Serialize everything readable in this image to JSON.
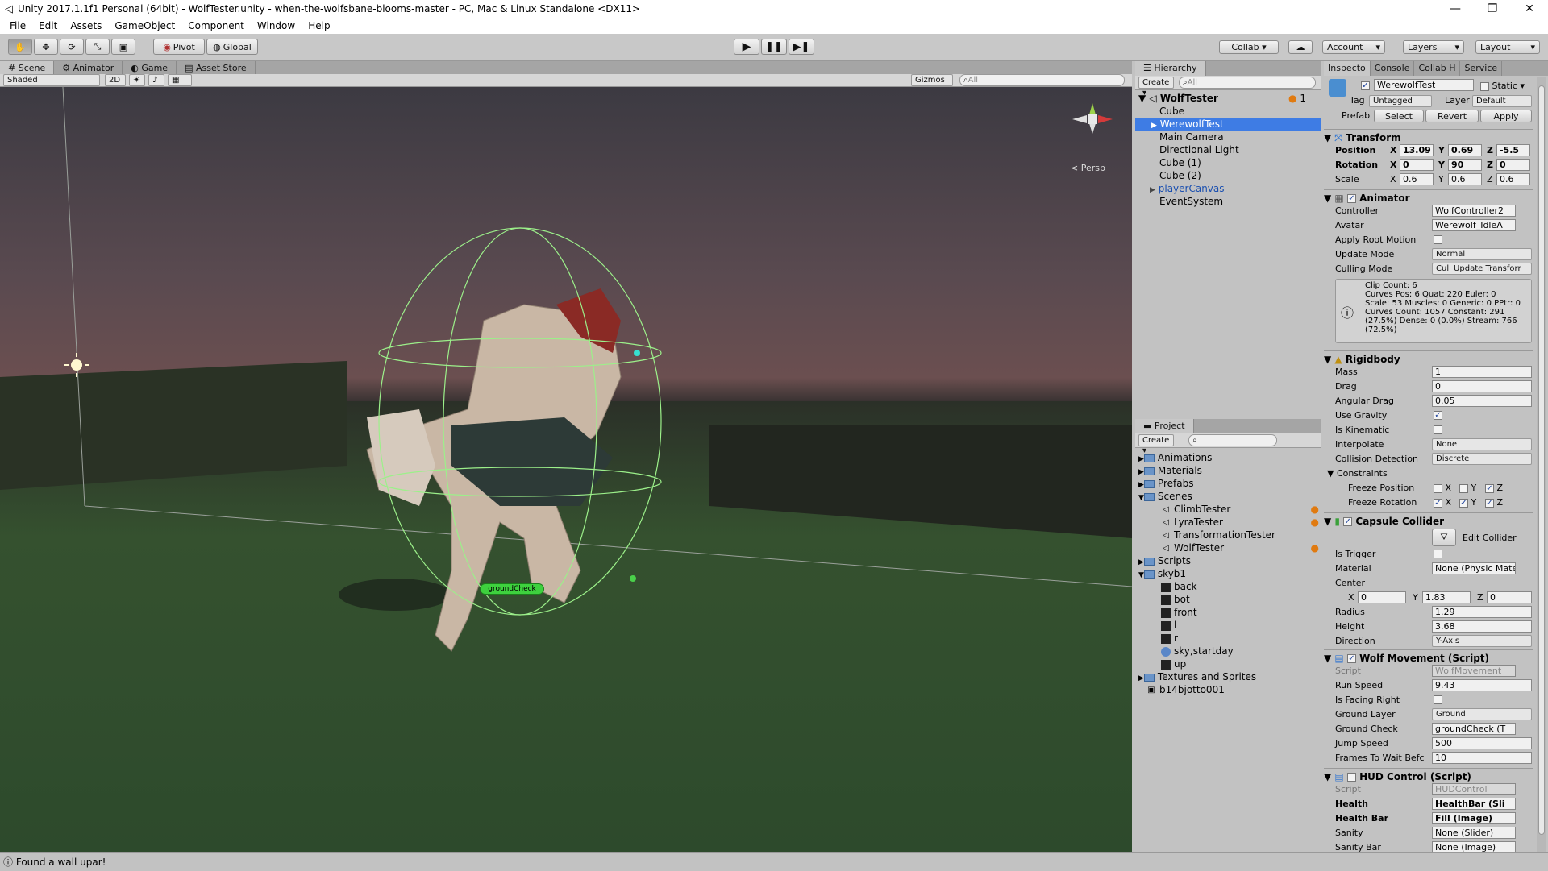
{
  "window": {
    "title": "Unity 2017.1.1f1 Personal (64bit) - WolfTester.unity - when-the-wolfsbane-blooms-master - PC, Mac & Linux Standalone <DX11>",
    "minimize": "—",
    "maximize": "❐",
    "close": "✕"
  },
  "menu": [
    "File",
    "Edit",
    "Assets",
    "GameObject",
    "Component",
    "Window",
    "Help"
  ],
  "toolbar": {
    "pivot": "Pivot",
    "global": "Global",
    "collab": "Collab ▾",
    "account": "Account",
    "layers": "Layers",
    "layout": "Layout"
  },
  "scene_tabs": {
    "scene": "Scene",
    "animator": "Animator",
    "game": "Game",
    "asset_store": "Asset Store"
  },
  "scene_bar": {
    "shaded": "Shaded",
    "twod": "2D",
    "gizmos": "Gizmos",
    "search_placeholder": "All"
  },
  "scene_view": {
    "persp": "< Persp",
    "ground_check_label": "groundCheck"
  },
  "hierarchy": {
    "tab": "Hierarchy",
    "create": "Create",
    "search_placeholder": "All",
    "scene": "WolfTester",
    "count": "1",
    "items": [
      "Cube",
      "WerewolfTest",
      "Main Camera",
      "Directional Light",
      "Cube (1)",
      "Cube (2)",
      "playerCanvas",
      "EventSystem"
    ]
  },
  "project": {
    "tab": "Project",
    "create": "Create",
    "items": [
      "Animations",
      "Materials",
      "Prefabs",
      "Scenes",
      "ClimbTester",
      "LyraTester",
      "TransformationTester",
      "WolfTester",
      "Scripts",
      "skyb1",
      "back",
      "bot",
      "front",
      "l",
      "r",
      "sky,startday",
      "up",
      "Textures and Sprites",
      "b14bjotto001"
    ]
  },
  "inspector": {
    "tabs": [
      "Inspecto",
      "Console",
      "Collab H",
      "Service"
    ],
    "object_name": "WerewolfTest",
    "static": "Static",
    "tag_label": "Tag",
    "tag": "Untagged",
    "layer_label": "Layer",
    "layer": "Default",
    "prefab_label": "Prefab",
    "select": "Select",
    "revert": "Revert",
    "apply": "Apply",
    "transform": {
      "title": "Transform",
      "position_label": "Position",
      "pos": [
        "13.09",
        "0.69",
        "-5.5"
      ],
      "rotation_label": "Rotation",
      "rot": [
        "0",
        "90",
        "0"
      ],
      "scale_label": "Scale",
      "scale": [
        "0.6",
        "0.6",
        "0.6"
      ]
    },
    "animator": {
      "title": "Animator",
      "controller_label": "Controller",
      "controller": "WolfController2",
      "avatar_label": "Avatar",
      "avatar": "Werewolf_IdleA",
      "apply_root_label": "Apply Root Motion",
      "update_mode_label": "Update Mode",
      "update_mode": "Normal",
      "culling_label": "Culling Mode",
      "culling": "Cull Update Transforr",
      "info": [
        "Clip Count: 6",
        "Curves Pos: 6 Quat: 220 Euler: 0",
        "Scale: 53 Muscles: 0 Generic: 0 PPtr: 0",
        "Curves Count: 1057 Constant: 291",
        "(27.5%) Dense: 0 (0.0%) Stream: 766",
        "(72.5%)"
      ]
    },
    "rigidbody": {
      "title": "Rigidbody",
      "mass_label": "Mass",
      "mass": "1",
      "drag_label": "Drag",
      "drag": "0",
      "angular_label": "Angular Drag",
      "angular": "0.05",
      "gravity_label": "Use Gravity",
      "kinematic_label": "Is Kinematic",
      "interpolate_label": "Interpolate",
      "interpolate": "None",
      "collision_label": "Collision Detection",
      "collision": "Discrete",
      "constraints_label": "Constraints",
      "freeze_pos_label": "Freeze Position",
      "freeze_rot_label": "Freeze Rotation"
    },
    "capsule": {
      "title": "Capsule Collider",
      "edit": "Edit Collider",
      "trigger_label": "Is Trigger",
      "material_label": "Material",
      "material": "None (Physic Mate",
      "center_label": "Center",
      "center": [
        "0",
        "1.83",
        "0"
      ],
      "radius_label": "Radius",
      "radius": "1.29",
      "height_label": "Height",
      "height": "3.68",
      "direction_label": "Direction",
      "direction": "Y-Axis"
    },
    "wolf": {
      "title": "Wolf Movement (Script)",
      "script_label": "Script",
      "script": "WolfMovement",
      "run_label": "Run Speed",
      "run": "9.43",
      "facing_label": "Is Facing Right",
      "ground_layer_label": "Ground Layer",
      "ground_layer": "Ground",
      "ground_check_label": "Ground Check",
      "ground_check": "groundCheck (T",
      "jump_label": "Jump Speed",
      "jump": "500",
      "frames_label": "Frames To Wait Befc",
      "frames": "10"
    },
    "hud": {
      "title": "HUD Control (Script)",
      "script_label": "Script",
      "script": "HUDControl",
      "health_label": "Health",
      "health": "HealthBar (Sli",
      "healthbar_label": "Health Bar",
      "healthbar": "Fill (Image)",
      "sanity_label": "Sanity",
      "sanity": "None (Slider)",
      "sanitybar_label": "Sanity Bar",
      "sanitybar": "None (Image)"
    }
  },
  "status": "Found a wall upar!"
}
